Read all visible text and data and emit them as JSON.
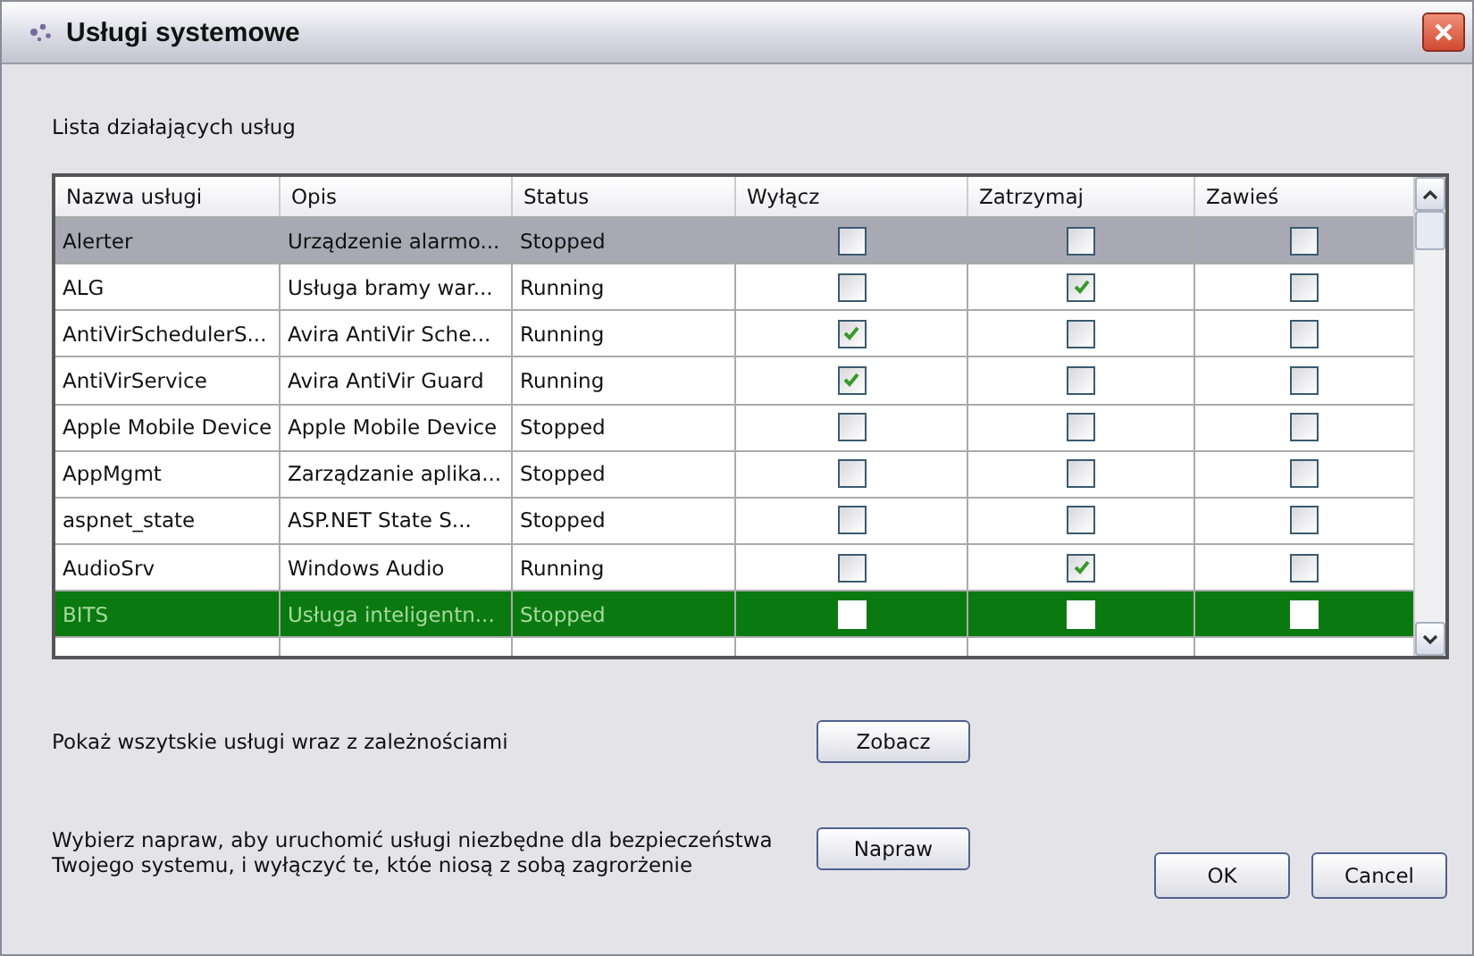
{
  "window": {
    "title": "Usługi systemowe"
  },
  "list_label": "Lista działających usług",
  "table": {
    "columns": [
      "Nazwa usługi",
      "Opis",
      "Status",
      "Wyłącz",
      "Zatrzymaj",
      "Zawieś"
    ],
    "rows": [
      {
        "name": "Alerter",
        "description": "Urządzenie alarmo...",
        "status": "Stopped",
        "disable": false,
        "stop": false,
        "suspend": false,
        "selected": false,
        "focused": true
      },
      {
        "name": "ALG",
        "description": "Usługa bramy war...",
        "status": "Running",
        "disable": false,
        "stop": true,
        "suspend": false,
        "selected": false,
        "focused": false
      },
      {
        "name": "AntiVirSchedulerS...",
        "description": "Avira AntiVir Sche...",
        "status": "Running",
        "disable": true,
        "stop": false,
        "suspend": false,
        "selected": false,
        "focused": false
      },
      {
        "name": "AntiVirService",
        "description": "Avira AntiVir Guard",
        "status": "Running",
        "disable": true,
        "stop": false,
        "suspend": false,
        "selected": false,
        "focused": false
      },
      {
        "name": "Apple Mobile Device",
        "description": "Apple Mobile Device",
        "status": "Stopped",
        "disable": false,
        "stop": false,
        "suspend": false,
        "selected": false,
        "focused": false
      },
      {
        "name": "AppMgmt",
        "description": "Zarządzanie aplika...",
        "status": "Stopped",
        "disable": false,
        "stop": false,
        "suspend": false,
        "selected": false,
        "focused": false
      },
      {
        "name": "aspnet_state",
        "description": "ASP.NET State S...",
        "status": "Stopped",
        "disable": false,
        "stop": false,
        "suspend": false,
        "selected": false,
        "focused": false
      },
      {
        "name": "AudioSrv",
        "description": "Windows Audio",
        "status": "Running",
        "disable": false,
        "stop": true,
        "suspend": false,
        "selected": false,
        "focused": false
      },
      {
        "name": "BITS",
        "description": "Usługa inteligentn...",
        "status": "Stopped",
        "disable": false,
        "stop": false,
        "suspend": false,
        "selected": true,
        "focused": false
      }
    ]
  },
  "show_all": {
    "text": "Pokaż wszytskie usługi wraz z zależnościami",
    "button": "Zobacz"
  },
  "repair": {
    "lines": [
      "Wybierz napraw, aby uruchomić usługi niezbędne dla bezpieczeństwa",
      "Twojego systemu, i wyłączyć te, któe niosą z sobą zagrorżenie"
    ],
    "button": "Napraw"
  },
  "buttons": [
    "OK",
    "Cancel"
  ]
}
